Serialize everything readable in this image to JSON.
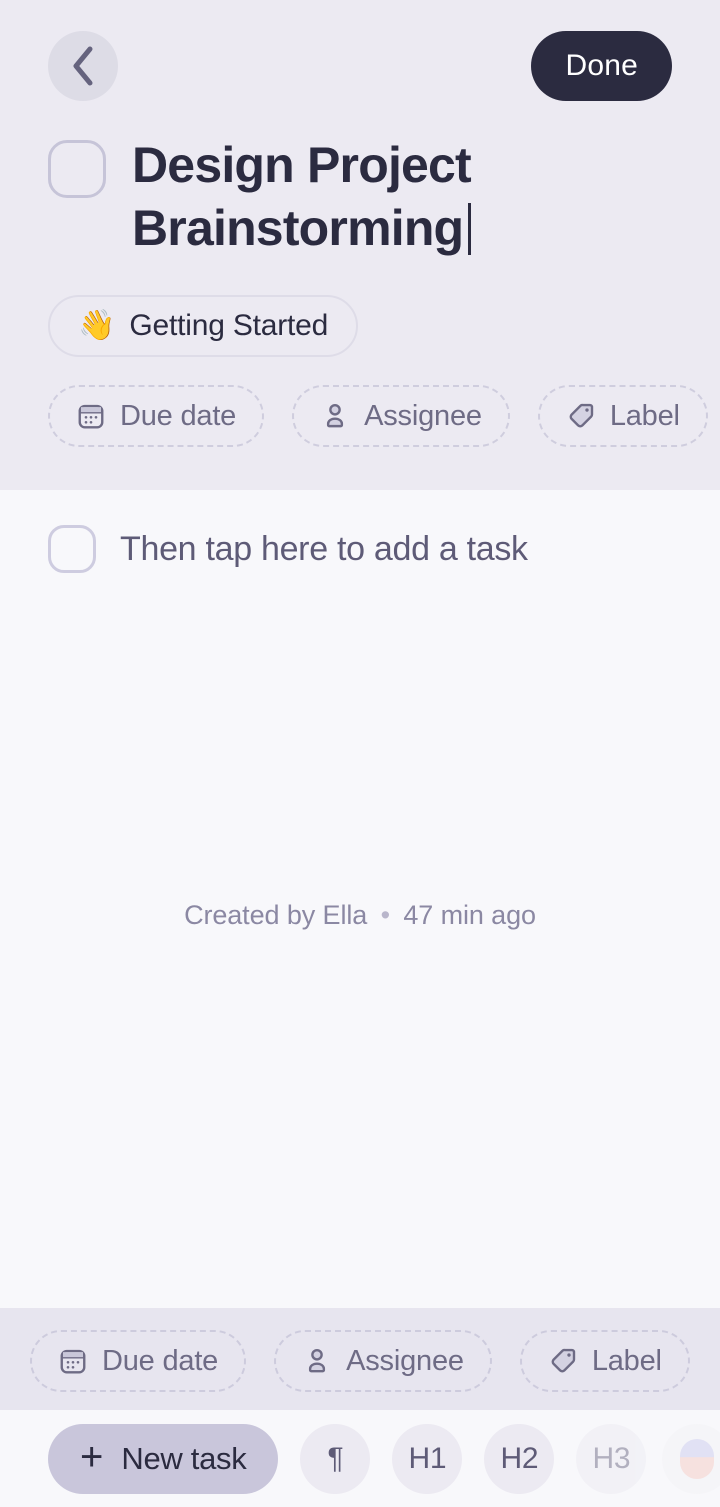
{
  "header": {
    "back_icon": "chevron-left-icon",
    "done_label": "Done",
    "title": "Design Project Brainstorming",
    "checkbox_state": "unchecked",
    "list_chip": {
      "emoji": "👋",
      "label": "Getting Started"
    },
    "meta_chips": [
      {
        "icon": "calendar-icon",
        "label": "Due date"
      },
      {
        "icon": "person-icon",
        "label": "Assignee"
      },
      {
        "icon": "tag-icon",
        "label": "Label"
      }
    ]
  },
  "body": {
    "task": {
      "label": "Then tap here to add a task",
      "checkbox_state": "unchecked"
    },
    "created": {
      "text": "Created by Ella",
      "separator": "•",
      "time": "47 min ago"
    }
  },
  "bottom_toolbar": {
    "meta_chips": [
      {
        "icon": "calendar-icon",
        "label": "Due date"
      },
      {
        "icon": "person-icon",
        "label": "Assignee"
      },
      {
        "icon": "tag-icon",
        "label": "Label"
      }
    ],
    "format_row": {
      "new_task": {
        "icon": "plus-icon",
        "label": "New task"
      },
      "buttons": [
        {
          "label": "¶",
          "name": "paragraph",
          "faded": false
        },
        {
          "label": "H1",
          "name": "heading-1",
          "faded": false
        },
        {
          "label": "H2",
          "name": "heading-2",
          "faded": false
        },
        {
          "label": "H3",
          "name": "heading-3",
          "faded": true
        }
      ],
      "color_picker": "color-picker-icon"
    }
  },
  "colors": {
    "header_bg": "#eceaf2",
    "body_bg": "#f8f8fb",
    "toolbar_bg": "#e7e5ef",
    "done_bg": "#2b2b40",
    "text_dark": "#2b2b40",
    "text_muted": "#6e6b85",
    "text_light": "#8b88a3",
    "newtask_bg": "#c9c6db"
  }
}
